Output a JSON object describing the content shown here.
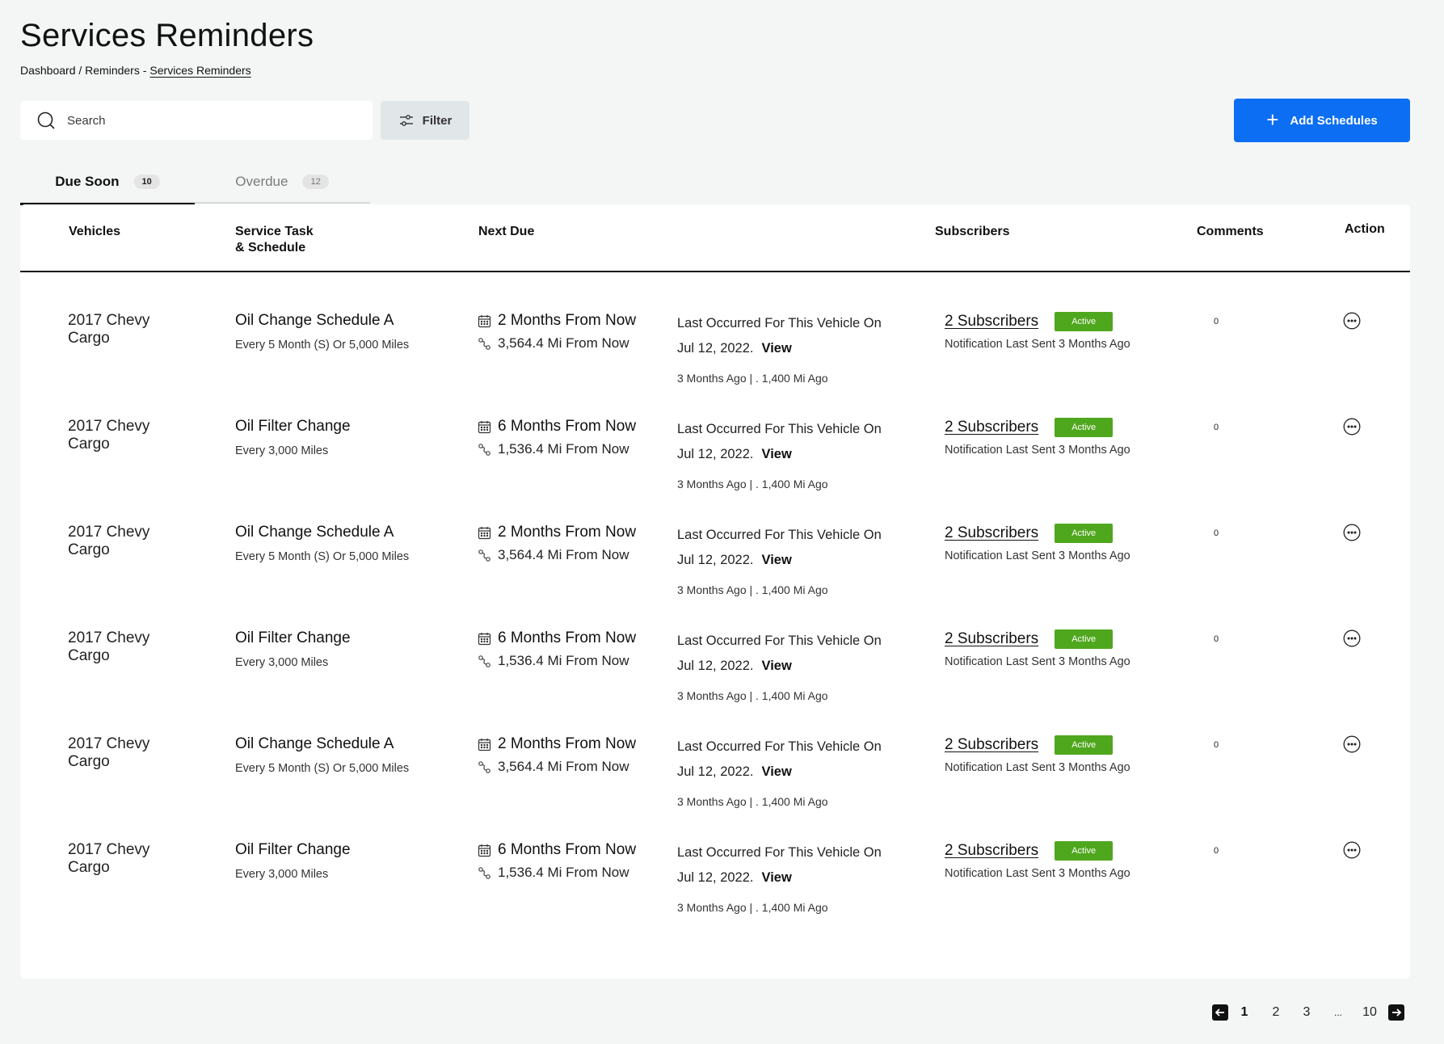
{
  "page": {
    "title": "Services Reminders",
    "breadcrumb": {
      "part1": "Dashboard / Reminders -",
      "current": "Services Reminders"
    }
  },
  "toolbar": {
    "search_placeholder": "Search",
    "filter_label": "Filter",
    "add_label": "Add Schedules",
    "add_color": "#0c6ef3"
  },
  "tabs": [
    {
      "label": "Due Soon",
      "count": "10",
      "active": true
    },
    {
      "label": "Overdue",
      "count": "12",
      "active": false
    }
  ],
  "table": {
    "headers": {
      "vehicles": "Vehicles",
      "task_line1": "Service Task",
      "task_line2": "& Schedule",
      "next_due": "Next Due",
      "subscribers": "Subscribers",
      "comments": "Comments",
      "action": "Action"
    },
    "rows": [
      {
        "vehicle_line1": "2017 Chevy",
        "vehicle_line2": "Cargo",
        "task": "Oil Change Schedule A",
        "schedule": "Every 5 Month (S) Or 5,000 Miles",
        "due_time": "2 Months From Now",
        "due_miles": "3,564.4 Mi From Now",
        "last_label": "Last Occurred For This Vehicle On",
        "last_date": "Jul 12, 2022.",
        "view_label": "View",
        "last_ago": "3 Months Ago  | . 1,400 Mi Ago",
        "subscribers": "2 Subscribers",
        "status": "Active",
        "notification": "Notification Last Sent 3 Months Ago",
        "comments": "0"
      },
      {
        "vehicle_line1": "2017 Chevy",
        "vehicle_line2": "Cargo",
        "task": "Oil Filter Change",
        "schedule": "Every 3,000 Miles",
        "due_time": "6 Months From Now",
        "due_miles": "1,536.4 Mi From Now",
        "last_label": "Last Occurred For This Vehicle On",
        "last_date": "Jul 12, 2022.",
        "view_label": "View",
        "last_ago": "3 Months Ago  | . 1,400 Mi Ago",
        "subscribers": "2 Subscribers",
        "status": "Active",
        "notification": "Notification Last Sent 3 Months Ago",
        "comments": "0"
      },
      {
        "vehicle_line1": "2017 Chevy",
        "vehicle_line2": "Cargo",
        "task": "Oil Change Schedule A",
        "schedule": "Every 5 Month (S) Or 5,000 Miles",
        "due_time": "2 Months From Now",
        "due_miles": "3,564.4 Mi From Now",
        "last_label": "Last Occurred For This Vehicle On",
        "last_date": "Jul 12, 2022.",
        "view_label": "View",
        "last_ago": "3 Months Ago  | . 1,400 Mi Ago",
        "subscribers": "2 Subscribers",
        "status": "Active",
        "notification": "Notification Last Sent 3 Months Ago",
        "comments": "0"
      },
      {
        "vehicle_line1": "2017 Chevy",
        "vehicle_line2": "Cargo",
        "task": "Oil Filter Change",
        "schedule": "Every 3,000 Miles",
        "due_time": "6 Months From Now",
        "due_miles": "1,536.4 Mi From Now",
        "last_label": "Last Occurred For This Vehicle On",
        "last_date": "Jul 12, 2022.",
        "view_label": "View",
        "last_ago": "3 Months Ago  | . 1,400 Mi Ago",
        "subscribers": "2 Subscribers",
        "status": "Active",
        "notification": "Notification Last Sent 3 Months Ago",
        "comments": "0"
      },
      {
        "vehicle_line1": "2017 Chevy",
        "vehicle_line2": "Cargo",
        "task": "Oil Change Schedule A",
        "schedule": "Every 5 Month (S) Or 5,000 Miles",
        "due_time": "2 Months From Now",
        "due_miles": "3,564.4 Mi From Now",
        "last_label": "Last Occurred For This Vehicle On",
        "last_date": "Jul 12, 2022.",
        "view_label": "View",
        "last_ago": "3 Months Ago  | . 1,400 Mi Ago",
        "subscribers": "2 Subscribers",
        "status": "Active",
        "notification": "Notification Last Sent 3 Months Ago",
        "comments": "0"
      },
      {
        "vehicle_line1": "2017 Chevy",
        "vehicle_line2": "Cargo",
        "task": "Oil Filter Change",
        "schedule": "Every 3,000 Miles",
        "due_time": "6 Months From Now",
        "due_miles": "1,536.4 Mi From Now",
        "last_label": "Last Occurred For This Vehicle On",
        "last_date": "Jul 12, 2022.",
        "view_label": "View",
        "last_ago": "3 Months Ago  | . 1,400 Mi Ago",
        "subscribers": "2 Subscribers",
        "status": "Active",
        "notification": "Notification Last Sent 3 Months Ago",
        "comments": "0"
      }
    ]
  },
  "status_color": "#4fa71d",
  "pagination": {
    "pages": [
      "1",
      "2",
      "3",
      "...",
      "10"
    ],
    "current": "1"
  },
  "icons": {
    "search": "search-icon",
    "filter": "sliders-icon",
    "add": "plus-icon",
    "due_time": "calendar-icon",
    "due_miles": "route-icon",
    "action": "more-horizontal-icon",
    "prev": "arrow-left-icon",
    "next": "arrow-right-icon"
  }
}
